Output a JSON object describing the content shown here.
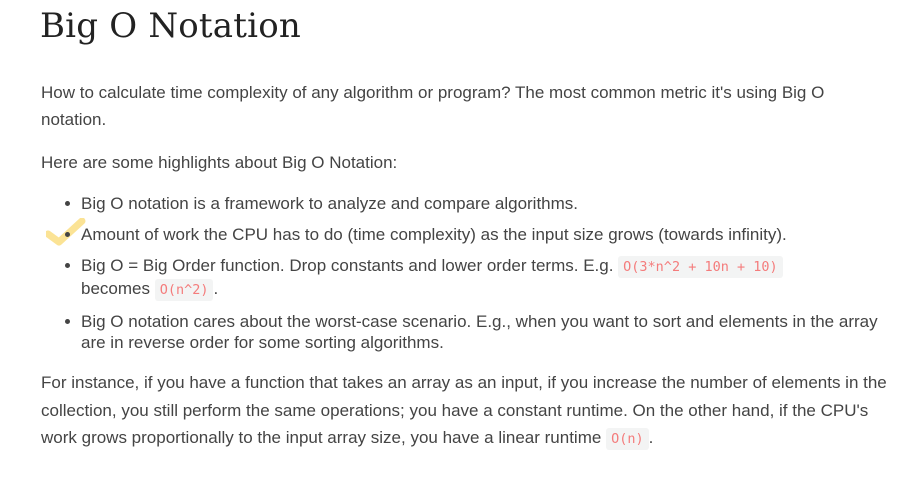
{
  "title": "Big O Notation",
  "intro": "How to calculate time complexity of any algorithm or program? The most common metric it's using Big O notation.",
  "highlights_intro": "Here are some highlights about Big O Notation:",
  "bullets": [
    {
      "text": "Big O notation is a framework to analyze and compare algorithms."
    },
    {
      "text": "Amount of work the CPU has to do (time complexity) as the input size grows (towards infinity)."
    },
    {
      "text_before": "Big O = Big Order function. Drop constants and lower order terms. E.g. ",
      "code1": "O(3*n^2 + 10n + 10)",
      "text_mid": " becomes ",
      "code2": "O(n^2)",
      "text_after": "."
    },
    {
      "text": "Big O notation cares about the worst-case scenario. E.g., when you want to sort and elements in the array are in reverse order for some sorting algorithms."
    }
  ],
  "closing": {
    "text": "For instance, if you have a function that takes an array as an input, if you increase the number of elements in the collection, you still perform the same operations; you have a constant runtime. On the other hand, if the CPU's work grows proportionally to the input array size, you have a linear runtime ",
    "code": "O(n)",
    "after": "."
  },
  "colors": {
    "text": "#444444",
    "code": "#f47c7c",
    "code_bg": "#f3f4f4",
    "checkmark": "#fbe08a"
  }
}
